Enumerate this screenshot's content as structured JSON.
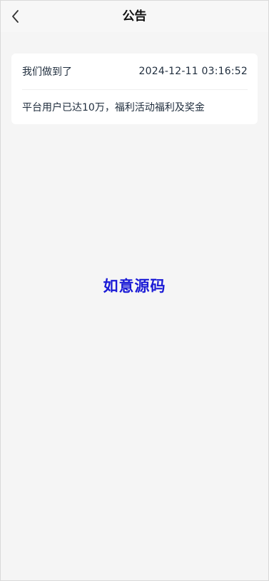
{
  "nav": {
    "title": "公告",
    "back_icon": "chevron-left-icon"
  },
  "announcement": {
    "title": "我们做到了",
    "time": "2024-12-11 03:16:52",
    "content": "平台用户已达10万，福利活动福利及奖金"
  },
  "watermark": {
    "text": "如意源码",
    "color": "#1a1ad6"
  }
}
